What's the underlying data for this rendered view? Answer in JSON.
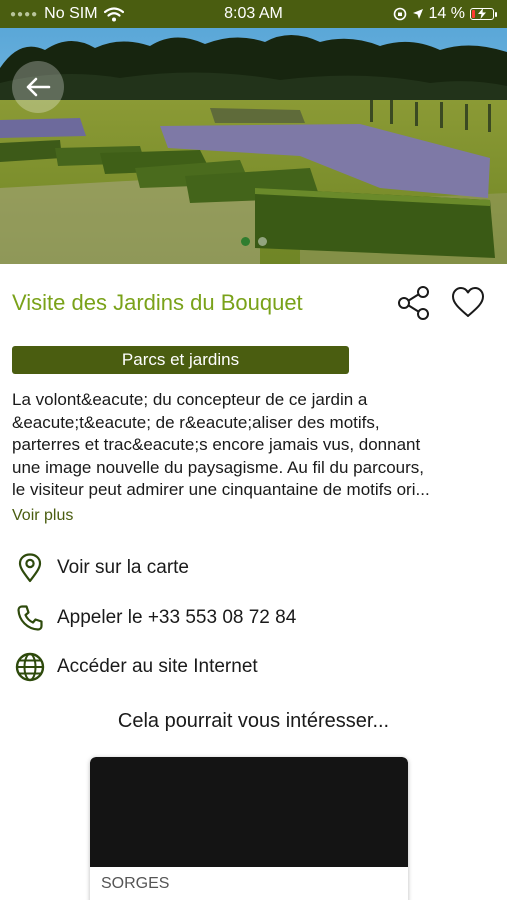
{
  "status_bar": {
    "carrier": "No SIM",
    "time": "8:03 AM",
    "battery_text": "14 %",
    "battery_level": 0.14,
    "battery_color": "#ff3b30",
    "icons": [
      "wifi-icon",
      "lock-rotation-icon",
      "location-arrow-icon",
      "battery-charging-icon"
    ]
  },
  "hero": {
    "icons": [
      "back-arrow-icon"
    ],
    "carousel": {
      "count": 2,
      "active_index": 0
    }
  },
  "place": {
    "title": "Visite des Jardins du Bouquet",
    "category": "Parcs et jardins",
    "description_lines": [
      "La volont&eacute; du concepteur de ce jardin a",
      "&eacute;t&eacute; de r&eacute;aliser des motifs,",
      "parterres et trac&eacute;s encore jamais vus, donnant",
      "une image nouvelle du paysagisme. Au fil du parcours,",
      "le visiteur peut admirer une cinquantaine de motifs ori..."
    ],
    "see_more": "Voir plus",
    "actions": [
      {
        "icon": "map-pin-icon",
        "label": "Voir sur la carte"
      },
      {
        "icon": "phone-icon",
        "label": "Appeler le +33 553 08 72 84"
      },
      {
        "icon": "globe-icon",
        "label": "Accéder au site Internet"
      }
    ]
  },
  "related": {
    "title": "Cela pourrait vous intéresser...",
    "cards": [
      {
        "location": "SORGES"
      }
    ]
  },
  "colors": {
    "brand_dark": "#4a5d10",
    "title_green": "#7aa21a",
    "icon_green": "#2e4a0c"
  }
}
